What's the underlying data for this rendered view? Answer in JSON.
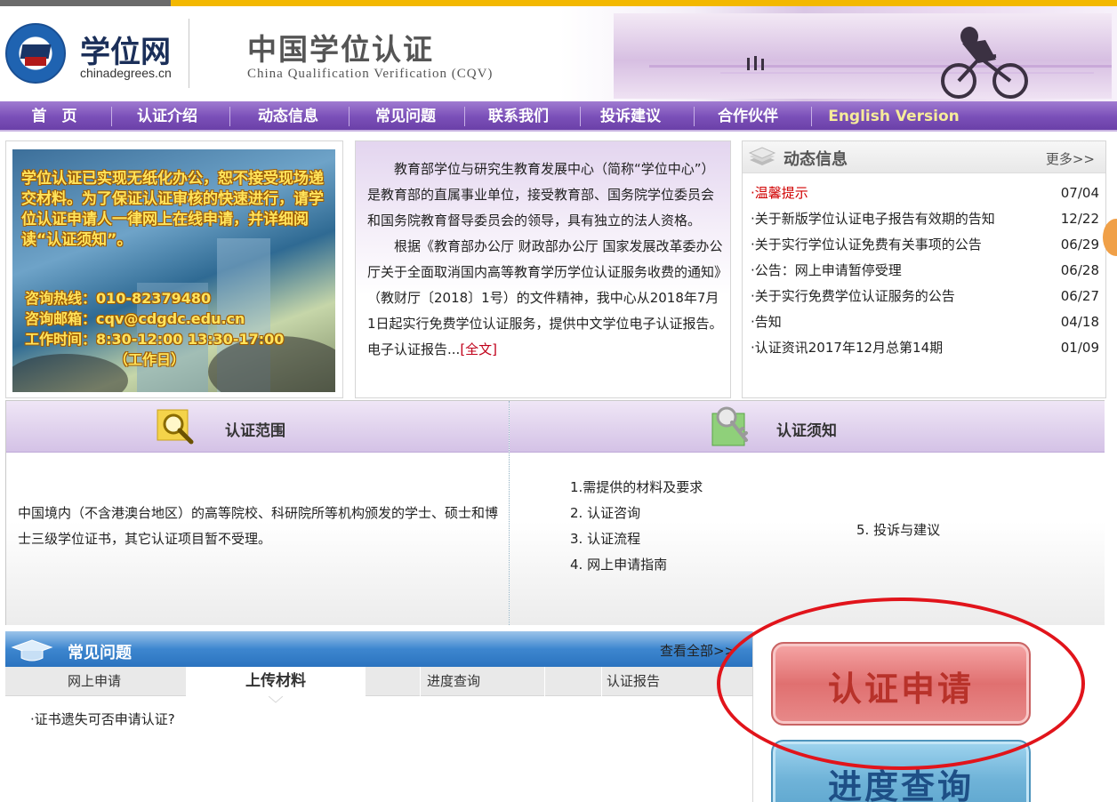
{
  "header": {
    "site_name": "学位网",
    "site_domain": "chinadegrees.cn",
    "title": "中国学位认证",
    "subtitle": "China Qualification Verification (CQV)"
  },
  "nav": {
    "items": [
      "首　页",
      "认证介绍",
      "动态信息",
      "常见问题",
      "联系我们",
      "投诉建议",
      "合作伙伴",
      "English Version"
    ]
  },
  "banner": {
    "line1": "学位认证已实现无纸化办公，恕不接受现场递交材料。为了保证认证审核的快速进行，请学位认证申请人一律网上在线申请，并详细阅读“认证须知”。",
    "hotline": "咨询热线：010-82379480",
    "email": "咨询邮箱：cqv@cdgdc.edu.cn",
    "hours": "工作时间：8:30-12:00 13:30-17:00",
    "workday": "（工作日）"
  },
  "intro": {
    "p1": "教育部学位与研究生教育发展中心（简称“学位中心”）是教育部的直属事业单位，接受教育部、国务院学位委员会和国务院教育督导委员会的领导，具有独立的法人资格。",
    "p2": "根据《教育部办公厅 财政部办公厅 国家发展改革委办公厅关于全面取消国内高等教育学历学位认证服务收费的通知》（教财厅〔2018〕1号）的文件精神，我中心从2018年7月1日起实行免费学位认证服务，提供中文学位电子认证报告。电子认证报告...",
    "more": "[全文]"
  },
  "news": {
    "title": "动态信息",
    "more": "更多>>",
    "items": [
      {
        "title": "·温馨提示",
        "date": "07/04"
      },
      {
        "title": "·关于新版学位认证电子报告有效期的告知",
        "date": "12/22"
      },
      {
        "title": "·关于实行学位认证免费有关事项的公告",
        "date": "06/29"
      },
      {
        "title": "·公告：网上申请暂停受理",
        "date": "06/28"
      },
      {
        "title": "·关于实行免费学位认证服务的公告",
        "date": "06/27"
      },
      {
        "title": "·告知",
        "date": "04/18"
      },
      {
        "title": "·认证资讯2017年12月总第14期",
        "date": "01/09"
      }
    ]
  },
  "cert": {
    "scope_title": "认证范围",
    "scope_text": "中国境内（不含港澳台地区）的高等院校、科研院所等机构颁发的学士、硕士和博士三级学位证书，其它认证项目暂不受理。",
    "notice_title": "认证须知",
    "notice_items": [
      "1.需提供的材料及要求",
      "2. 认证咨询",
      "3. 认证流程",
      "4. 网上申请指南"
    ],
    "notice_side": "5. 投诉与建议"
  },
  "faq": {
    "title": "常见问题",
    "view_all": "查看全部>>",
    "tabs": [
      "网上申请",
      "上传材料",
      "进度查询",
      "认证报告"
    ],
    "active_tab": 1,
    "item": "·证书遗失可否申请认证?"
  },
  "buttons": {
    "apply": "认证申请",
    "progress": "进度查询"
  },
  "colors": {
    "nav": "#7a4fb8",
    "accent_yellow": "#f3b800",
    "apply_button": "#e07070",
    "progress_button": "#6fb3d8",
    "highlight_ellipse": "#e1141b"
  }
}
